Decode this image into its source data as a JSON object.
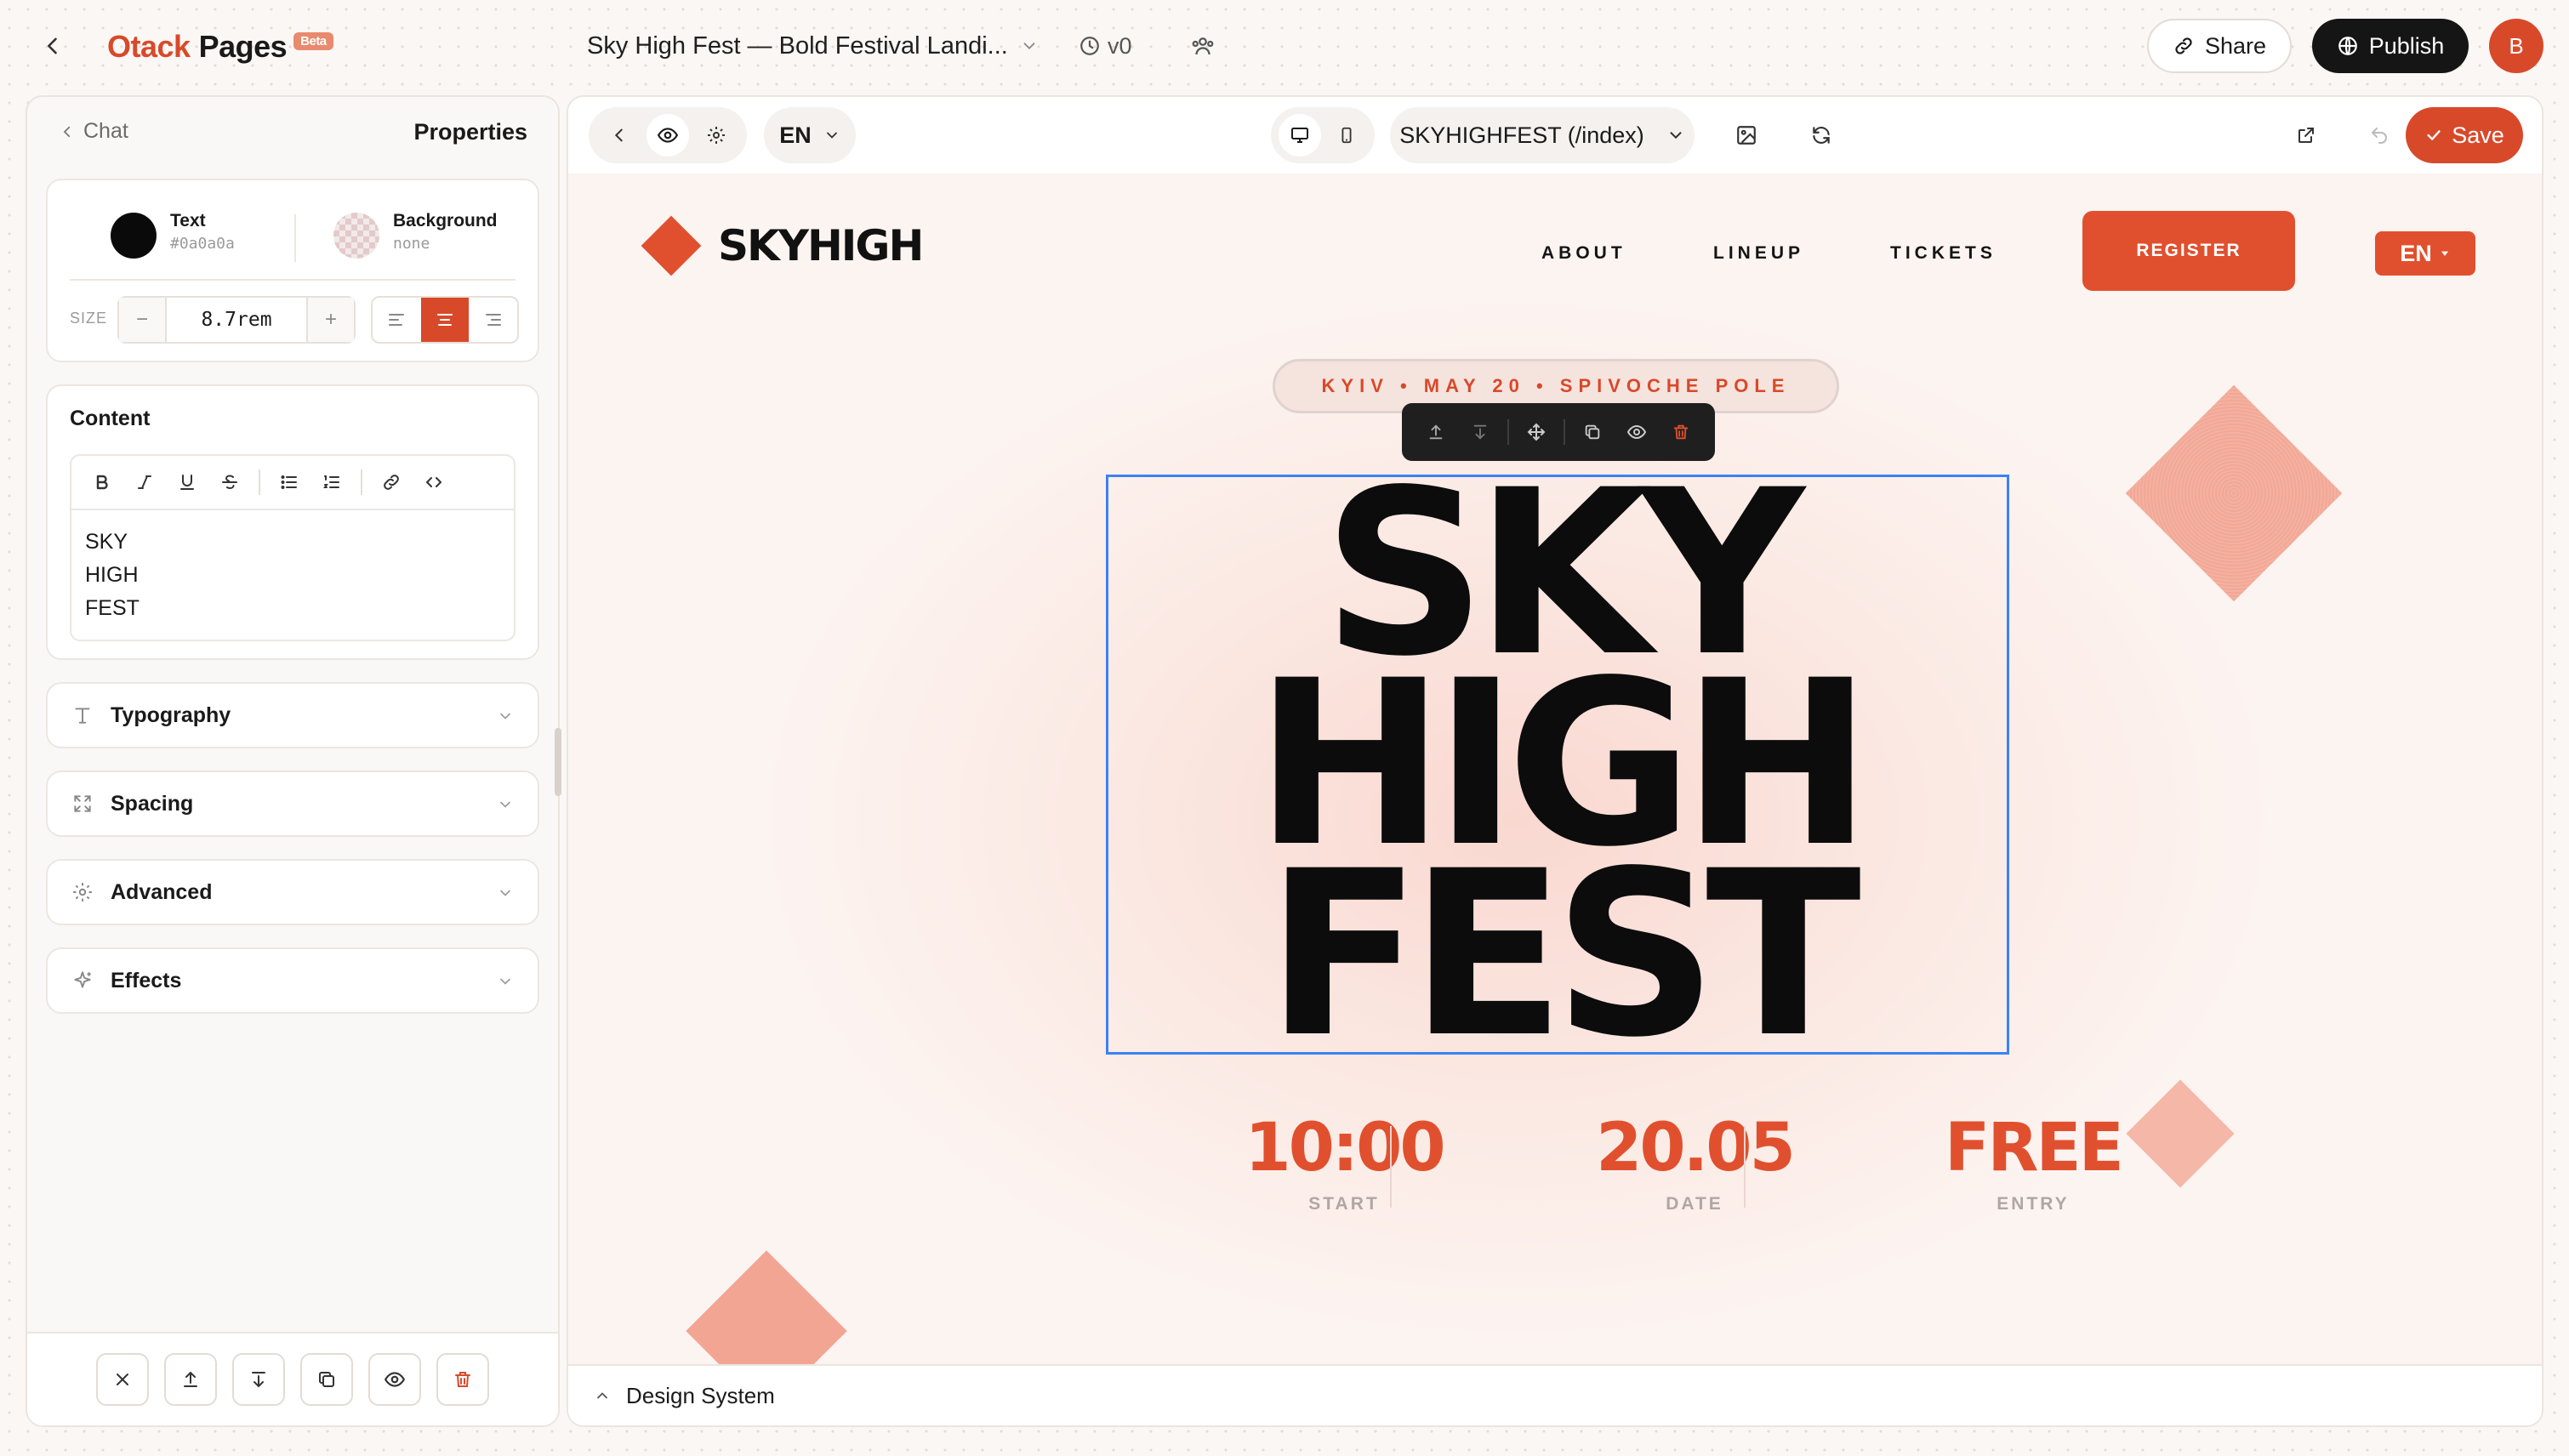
{
  "app": {
    "brand": "Otack",
    "brand_suffix": "Pages",
    "beta_badge": "Beta",
    "document_title": "Sky High Fest — Bold Festival Landi...",
    "version": "v0",
    "share_label": "Share",
    "publish_label": "Publish",
    "avatar_initial": "B"
  },
  "left_panel": {
    "chat_label": "Chat",
    "title": "Properties",
    "text_color": {
      "label": "Text",
      "value": "#0a0a0a"
    },
    "background_color": {
      "label": "Background",
      "value": "none"
    },
    "size": {
      "label": "SIZE",
      "value": "8.7rem",
      "minus": "−",
      "plus": "+"
    },
    "text_align": "center",
    "content": {
      "title": "Content",
      "lines": [
        "SKY",
        "HIGH",
        "FEST"
      ]
    },
    "sections": {
      "typography": "Typography",
      "spacing": "Spacing",
      "advanced": "Advanced",
      "effects": "Effects"
    }
  },
  "canvas_toolbar": {
    "language": "EN",
    "page_selector": "SKYHIGHFEST (/index)",
    "save_label": "Save"
  },
  "site": {
    "logo_text": "SKYHIGH",
    "nav": {
      "about": "ABOUT",
      "lineup": "LINEUP",
      "tickets": "TICKETS"
    },
    "register_label": "REGISTER",
    "language": "EN",
    "location": "KYIV • MAY 20 • SPIVOCHE POLE",
    "hero_lines": [
      "SKY",
      "HIGH",
      "FEST"
    ],
    "stats": [
      {
        "value": "10:00",
        "label": "START"
      },
      {
        "value": "20.05",
        "label": "DATE"
      },
      {
        "value": "FREE",
        "label": "ENTRY"
      }
    ],
    "accent_color": "#e1502e"
  },
  "design_system_label": "Design System",
  "colors": {
    "accent": "#d8492a",
    "selection_outline": "#3b82f6",
    "dark_button": "#151515"
  }
}
